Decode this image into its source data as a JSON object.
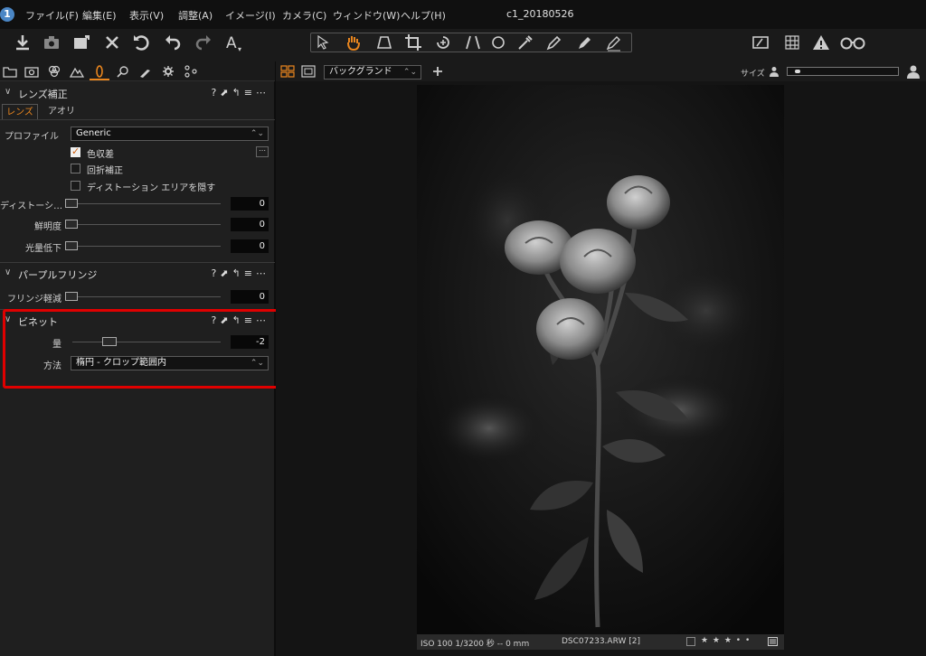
{
  "menubar": {
    "items": [
      "ファイル(F)",
      "編集(E)",
      "表示(V)",
      "調整(A)",
      "イメージ(I)",
      "カメラ(C)",
      "ウィンドウ(W)",
      "ヘルプ(H)"
    ],
    "window_title": "c1_20180526"
  },
  "viewer_toolbar": {
    "background_dropdown": "バックグランド",
    "size_label": "サイズ"
  },
  "lens_section": {
    "title": "レンズ補正",
    "tabs": [
      "レンズ",
      "アオリ"
    ],
    "profile_label": "プロファイル",
    "profile_value": "Generic",
    "checkboxes": [
      {
        "label": "色収差",
        "checked": true
      },
      {
        "label": "回折補正",
        "checked": false
      },
      {
        "label": "ディストーション エリアを隠す",
        "checked": false
      }
    ],
    "sliders": [
      {
        "label": "ディストーシ…",
        "value": "0"
      },
      {
        "label": "鮮明度",
        "value": "0"
      },
      {
        "label": "光量低下",
        "value": "0"
      }
    ]
  },
  "fringe_section": {
    "title": "パープルフリンジ",
    "slider_label": "フリンジ軽減",
    "slider_value": "0"
  },
  "vignette_section": {
    "title": "ビネット",
    "amount_label": "量",
    "amount_value": "-2",
    "method_label": "方法",
    "method_value": "楕円 - クロップ範囲内"
  },
  "statusbar": {
    "exif": "ISO 100  1/3200 秒  --  0 mm",
    "filename": "DSC07233.ARW [2]",
    "rating": "★ ★ ★ • •"
  },
  "colors": {
    "accent": "#e8851e",
    "highlight_box": "#e00000",
    "panel_bg": "#1f1f1f"
  }
}
